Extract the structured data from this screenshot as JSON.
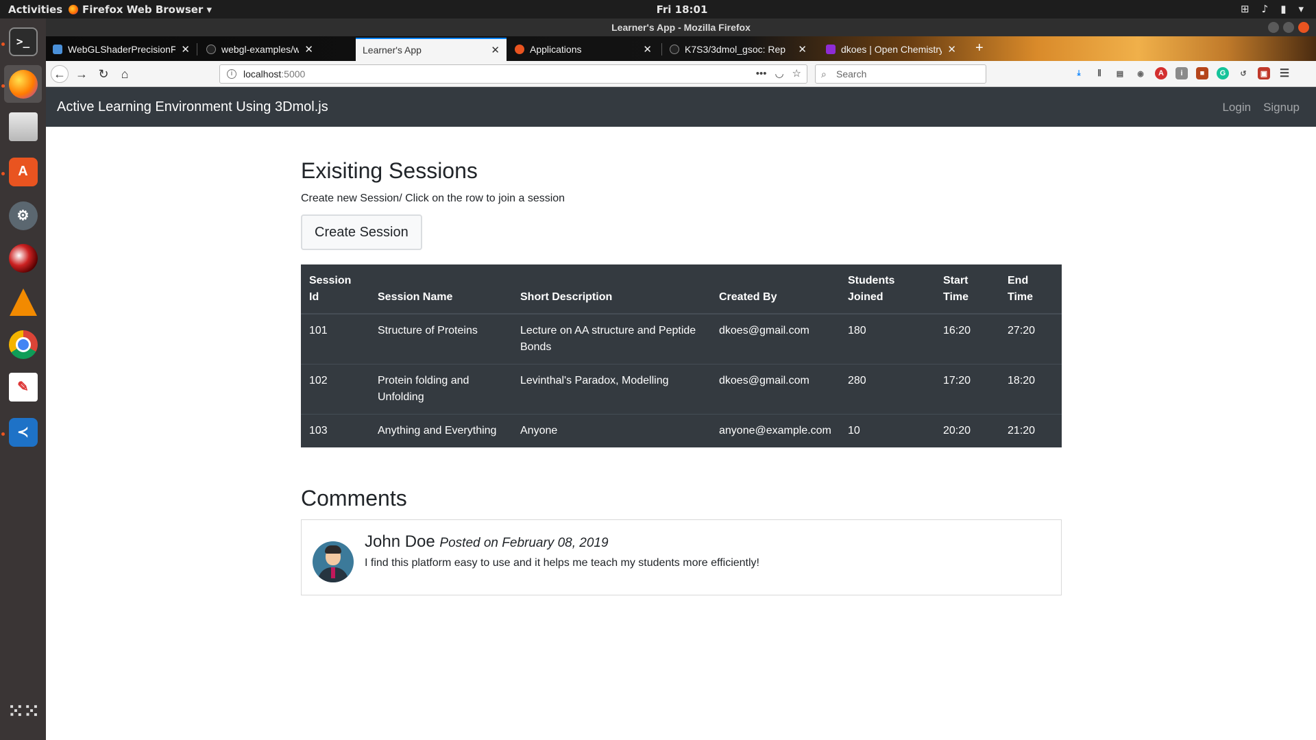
{
  "topbar": {
    "activities": "Activities",
    "app_menu": "Firefox Web Browser ▾",
    "clock": "Fri 18:01"
  },
  "window": {
    "title": "Learner's App - Mozilla Firefox"
  },
  "tabs": [
    {
      "title": "WebGLShaderPrecisionF",
      "favicon_color": "#4a90d9"
    },
    {
      "title": "webgl-examples/webgl-",
      "favicon_color": "#222222"
    },
    {
      "title": "Learner's App",
      "favicon_color": ""
    },
    {
      "title": "Applications",
      "favicon_color": "#e95420"
    },
    {
      "title": "K7S3/3dmol_gsoc: Rep",
      "favicon_color": "#222222"
    },
    {
      "title": "dkoes | Open Chemistry",
      "favicon_color": "#8e2cd6"
    }
  ],
  "navbar": {
    "url_host": "localhost",
    "url_port": ":5000",
    "search_placeholder": "Search"
  },
  "app": {
    "brand": "Active Learning Environment Using 3Dmol.js",
    "login": "Login",
    "signup": "Signup",
    "sessions_title": "Exisiting Sessions",
    "subtitle": "Create new Session/ Click on the row to join a session",
    "create_button": "Create Session",
    "table": {
      "headers": {
        "id_1": "Session",
        "id_2": "Id",
        "name": "Session Name",
        "desc": "Short Description",
        "created": "Created By",
        "students_1": "Students",
        "students_2": "Joined",
        "start_1": "Start",
        "start_2": "Time",
        "end_1": "End",
        "end_2": "Time"
      },
      "rows": [
        {
          "id": "101",
          "name": "Structure of Proteins",
          "desc": "Lecture on AA structure and Peptide Bonds",
          "created_by": "dkoes@gmail.com",
          "students": "180",
          "start": "16:20",
          "end": "27:20"
        },
        {
          "id": "102",
          "name": "Protein folding and Unfolding",
          "desc": "Levinthal's Paradox, Modelling",
          "created_by": "dkoes@gmail.com",
          "students": "280",
          "start": "17:20",
          "end": "18:20"
        },
        {
          "id": "103",
          "name": "Anything and Everything",
          "desc": "Anyone",
          "created_by": "anyone@example.com",
          "students": "10",
          "start": "20:20",
          "end": "21:20"
        }
      ]
    },
    "comments_title": "Comments",
    "comments": [
      {
        "author": "John Doe",
        "posted": "Posted on February 08, 2019",
        "text": "I find this platform easy to use and it helps me teach my students more efficiently!"
      }
    ]
  }
}
